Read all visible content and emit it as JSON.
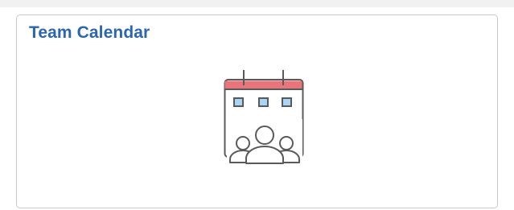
{
  "tile": {
    "title": "Team Calendar",
    "icon": "team-calendar-icon",
    "title_color": "#2b66b1",
    "accent_color": "#e8747c",
    "square_fill": "#a9d4f5",
    "line_color": "#5a5a5a",
    "border_color": "#c8c8c8"
  }
}
